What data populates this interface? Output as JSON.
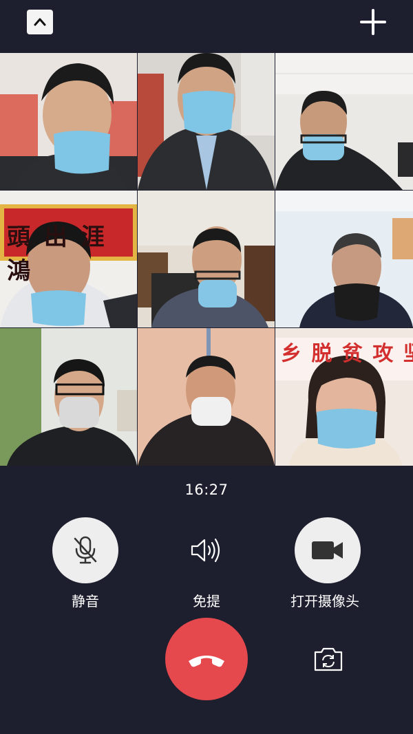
{
  "call": {
    "timer": "16:27"
  },
  "controls": {
    "mute_label": "静音",
    "speaker_label": "免提",
    "camera_label": "打开摄像头"
  },
  "participants": [
    {
      "id": "p1",
      "banner": ""
    },
    {
      "id": "p2",
      "banner": ""
    },
    {
      "id": "p3",
      "banner": ""
    },
    {
      "id": "p4",
      "banner": "頭 出 涯 鴻"
    },
    {
      "id": "p5",
      "banner": ""
    },
    {
      "id": "p6",
      "banner": ""
    },
    {
      "id": "p7",
      "banner": ""
    },
    {
      "id": "p8",
      "banner": ""
    },
    {
      "id": "p9",
      "banner": "乡 脱 贫 攻 坚 \" 工"
    }
  ],
  "icons": {
    "collapse": "chevron-up-icon",
    "add": "plus-icon",
    "mute": "microphone-off-icon",
    "speaker": "speaker-icon",
    "camera": "video-camera-icon",
    "hangup": "phone-hangup-icon",
    "switch_camera": "camera-switch-icon"
  },
  "colors": {
    "background": "#1d1f2e",
    "hangup": "#e5484d",
    "control_circle": "#eeeeee"
  }
}
